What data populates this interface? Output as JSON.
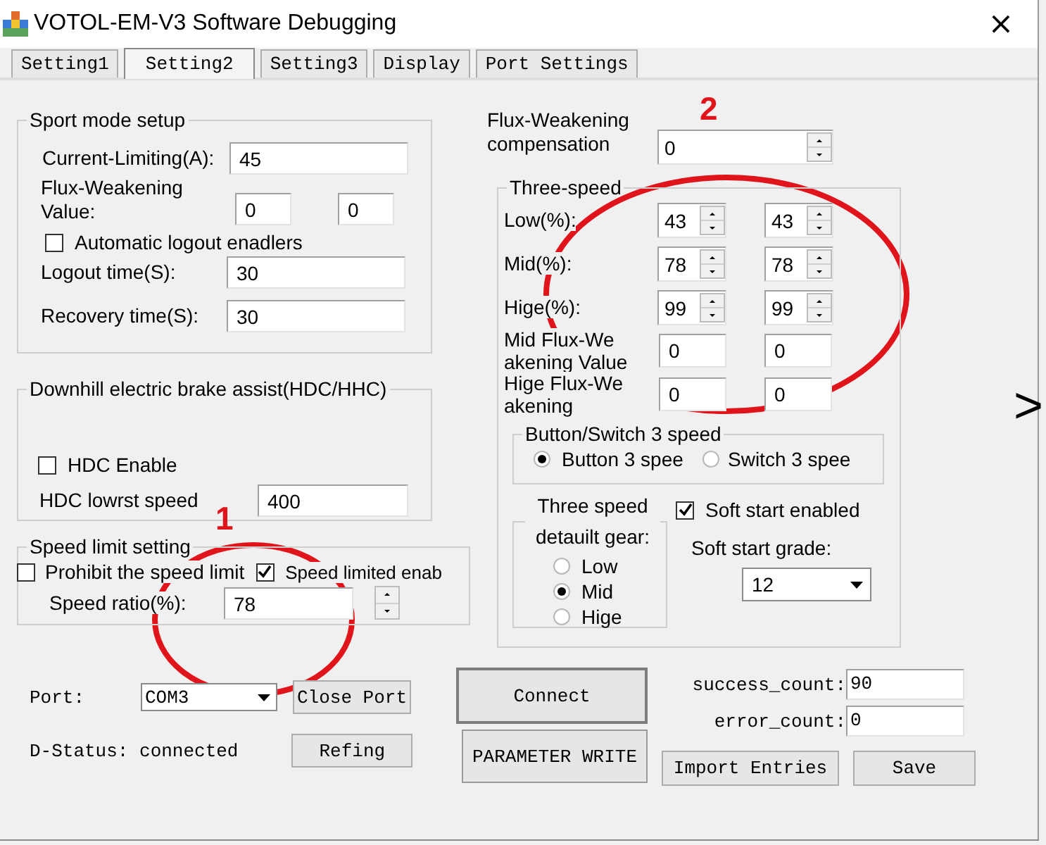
{
  "window": {
    "title": "VOTOL-EM-V3 Software Debugging",
    "close": "×"
  },
  "tabs": [
    {
      "label": "Setting1",
      "selected": false
    },
    {
      "label": "Setting2",
      "selected": true
    },
    {
      "label": "Setting3",
      "selected": false
    },
    {
      "label": "Display",
      "selected": false
    },
    {
      "label": "Port Settings",
      "selected": false
    }
  ],
  "sport_mode": {
    "title": "Sport mode setup",
    "current_limiting": {
      "label": "Current-Limiting(A):",
      "value": "45"
    },
    "flux_weakening": {
      "label": "Flux-Weakening Value:",
      "values": [
        "0",
        "0"
      ]
    },
    "auto_logout": {
      "label": "Automatic logout enadlers",
      "checked": false
    },
    "logout_time": {
      "label": "Logout time(S):",
      "value": "30"
    },
    "recovery_time": {
      "label": "Recovery time(S):",
      "value": "30"
    }
  },
  "downhill": {
    "title": "Downhill electric brake assist(HDC/HHC)",
    "hdc_enable": {
      "label": "HDC Enable",
      "checked": false
    },
    "hdc_lowest_speed": {
      "label": "HDC lowrst speed",
      "value": "400"
    }
  },
  "speed_limit": {
    "title": "Speed limit setting",
    "checkboxes": [
      {
        "label": "Prohibit the speed limit",
        "checked": false
      },
      {
        "label": "Speed limited enab",
        "checked": true
      }
    ],
    "speed_ratio": {
      "label": "Speed ratio(%):",
      "value": "78"
    }
  },
  "flux_compensation": {
    "label": "Flux-Weakening compensation",
    "value": "0"
  },
  "three_speed": {
    "title": "Three-speed",
    "rows": [
      {
        "kind": "spinner",
        "label": "Low(%):",
        "values": [
          "43",
          "43"
        ]
      },
      {
        "kind": "spinner",
        "label": "Mid(%):",
        "values": [
          "78",
          "78"
        ]
      },
      {
        "kind": "spinner",
        "label": "Hige(%):",
        "values": [
          "99",
          "99"
        ]
      },
      {
        "kind": "field",
        "label": "Mid Flux-We akening Value",
        "values": [
          "0",
          "0"
        ]
      },
      {
        "kind": "field",
        "label": "Hige Flux-We akening",
        "values": [
          "0",
          "0"
        ]
      }
    ],
    "switch_mode": {
      "title": "Button/Switch 3 speed",
      "options": [
        {
          "label": "Button 3 spee",
          "selected": true
        },
        {
          "label": "Switch 3 spee",
          "selected": false
        }
      ]
    },
    "default_gear": {
      "title": "Three speed detauilt gear:",
      "options": [
        {
          "label": "Low",
          "selected": false
        },
        {
          "label": "Mid",
          "selected": true
        },
        {
          "label": "Hige",
          "selected": false
        }
      ]
    },
    "soft_start": {
      "label": "Soft start enabled",
      "checked": true
    },
    "soft_start_grade": {
      "label": "Soft start grade:",
      "value": "12"
    }
  },
  "next_arrow": ">",
  "connection": {
    "port_label": "Port:",
    "port_value": "COM3",
    "status": "D-Status: connected"
  },
  "buttons": [
    {
      "kind": "close_port",
      "label": "Close Port"
    },
    {
      "kind": "refresh",
      "label": "Refing"
    },
    {
      "kind": "connect",
      "label": "Connect"
    },
    {
      "kind": "write",
      "label": "PARAMETER WRITE"
    },
    {
      "kind": "import",
      "label": "Import Entries"
    },
    {
      "kind": "save",
      "label": "Save"
    }
  ],
  "counts": [
    {
      "label": "success_count:",
      "value": "90"
    },
    {
      "label": "error_count:",
      "value": "0"
    }
  ],
  "annotations": [
    {
      "text": "1"
    },
    {
      "text": "2"
    }
  ]
}
